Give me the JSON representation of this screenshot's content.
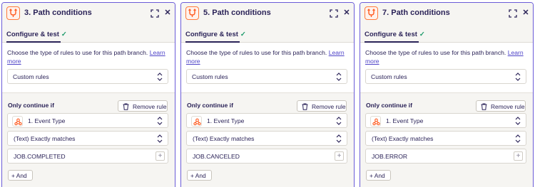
{
  "panels": [
    {
      "title": "3. Path conditions",
      "tab_label": "Configure & test",
      "description": "Choose the type of rules to use for this path branch.",
      "learn_more": "Learn more",
      "rule_type": "Custom rules",
      "only_continue_label": "Only continue if",
      "remove_rule_label": "Remove rule",
      "field_label": "1. Event Type",
      "condition": "(Text) Exactly matches",
      "value": "JOB.COMPLETED",
      "and_label": "And"
    },
    {
      "title": "5. Path conditions",
      "tab_label": "Configure & test",
      "description": "Choose the type of rules to use for this path branch.",
      "learn_more": "Learn more",
      "rule_type": "Custom rules",
      "only_continue_label": "Only continue if",
      "remove_rule_label": "Remove rule",
      "field_label": "1. Event Type",
      "condition": "(Text) Exactly matches",
      "value": "JOB.CANCELED",
      "and_label": "And"
    },
    {
      "title": "7. Path conditions",
      "tab_label": "Configure & test",
      "description": "Choose the type of rules to use for this path branch.",
      "learn_more": "Learn more",
      "rule_type": "Custom rules",
      "only_continue_label": "Only continue if",
      "remove_rule_label": "Remove rule",
      "field_label": "1. Event Type",
      "condition": "(Text) Exactly matches",
      "value": "JOB.ERROR",
      "and_label": "And"
    }
  ],
  "icons": {
    "app": "path-split-icon",
    "expand": "expand-icon",
    "close": "close-icon",
    "check": "check-icon",
    "trash": "trash-icon",
    "webhook": "webhook-icon",
    "chevron": "chevron-updown-icon",
    "plus": "plus-icon"
  },
  "colors": {
    "accent_border": "#6a5bd8",
    "app_orange": "#ff7a3d",
    "check_green": "#1e9b6b",
    "link": "#4f44c8",
    "text": "#2b2358"
  }
}
